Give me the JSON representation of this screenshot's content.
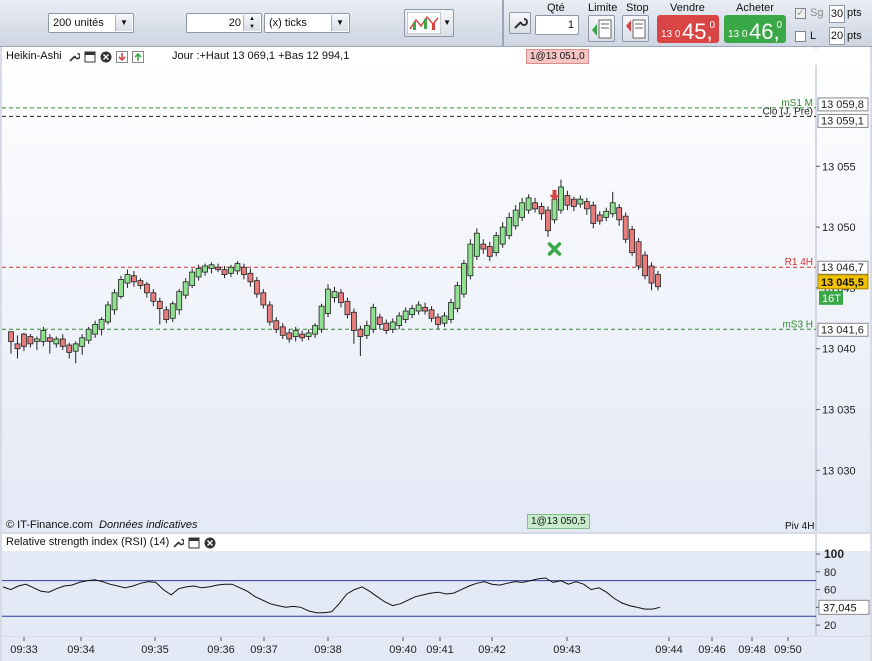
{
  "toolbar": {
    "units_value": "200 unités",
    "ticks_value": "20",
    "ticks_unit": "(x) ticks",
    "qty_label": "Qté",
    "qty_value": "1",
    "limit_label": "Limite",
    "stop_label": "Stop",
    "sell_label": "Vendre",
    "sell_small": "13 0",
    "sell_big": "45,",
    "sell_dec": "0",
    "buy_label": "Acheter",
    "buy_small": "13 0",
    "buy_big": "46,",
    "buy_dec": "0",
    "sg_label": "Sg",
    "l_label": "L",
    "pts_top": "30",
    "pts_bottom": "20",
    "pts_label": "pts",
    "colors": {
      "sell": "#d94545",
      "buy": "#3aa847"
    }
  },
  "main_panel": {
    "title": "Heikin-Ashi",
    "info": "Jour :+Haut 13 069,1 +Bas 12 994,1",
    "order_top": "1@13 051,0",
    "order_bottom": "1@13 050,5",
    "copyright": "© IT-Finance.com",
    "data_note": "Données indicatives",
    "piv_label": "Piv 4H",
    "icons": [
      "wrench-icon",
      "window-icon",
      "close-icon",
      "arrow-down-icon",
      "arrow-up-icon"
    ]
  },
  "rsi_panel": {
    "title": "Relative strength index (RSI) (14)",
    "value_label": "37,045"
  },
  "chart_data": [
    {
      "type": "candlestick",
      "chart_style": "Heikin-Ashi",
      "ylim": [
        13026,
        13063
      ],
      "yticks": [
        13030,
        13035,
        13040,
        13045,
        13050,
        13055
      ],
      "ytick_labels": [
        "13 030",
        "13 035",
        "13 040",
        "13 045",
        "13 050",
        "13 055"
      ],
      "xtick_labels": [
        "09:33",
        "09:34",
        "09:35",
        "09:36",
        "09:37",
        "09:38",
        "09:40",
        "09:41",
        "09:42",
        "09:43",
        "09:44",
        "09:46",
        "09:48",
        "09:50"
      ],
      "levels": [
        {
          "name": "mS1 M",
          "value": 13059.8,
          "label": "13 059,8",
          "color": "#2e8b2e",
          "style": "dashed"
        },
        {
          "name": "Clo (J, Pre)",
          "value": 13059.1,
          "label": "13 059,1",
          "color": "#222222",
          "style": "dashed"
        },
        {
          "name": "R1 4H",
          "value": 13046.7,
          "label": "13 046,7",
          "color": "#d03030",
          "style": "dashed"
        },
        {
          "name": "mS3 H",
          "value": 13041.6,
          "label": "13 041,6",
          "color": "#2e8b2e",
          "style": "dashed"
        }
      ],
      "current_price": {
        "value": 13045.5,
        "label": "13 045,5"
      },
      "tick_badge": "16T",
      "signals": [
        {
          "type": "arrow-down",
          "color": "#d94545",
          "value": 13052.4
        },
        {
          "type": "cross",
          "color": "#3aa847",
          "value": 13048.2
        }
      ],
      "candles": [
        [
          13041.4,
          13040.6,
          13041.0,
          13039.6
        ],
        [
          13040.4,
          13040.0,
          13041.1,
          13039.2
        ],
        [
          13041.2,
          13040.2,
          13041.3,
          13039.8
        ],
        [
          13041.0,
          13040.4,
          13041.2,
          13040.1
        ],
        [
          13040.6,
          13040.8,
          13041.0,
          13039.9
        ],
        [
          13040.6,
          13041.5,
          13041.8,
          13040.2
        ],
        [
          13040.9,
          13040.6,
          13041.2,
          13039.6
        ],
        [
          13040.4,
          13040.8,
          13041.0,
          13040.1
        ],
        [
          13040.8,
          13040.2,
          13041.2,
          13039.9
        ],
        [
          13040.3,
          13039.7,
          13040.5,
          13039.2
        ],
        [
          13039.8,
          13040.4,
          13040.6,
          13038.8
        ],
        [
          13040.2,
          13040.9,
          13041.2,
          13039.5
        ],
        [
          13040.7,
          13041.6,
          13041.8,
          13040.4
        ],
        [
          13041.2,
          13042.0,
          13042.3,
          13040.9
        ],
        [
          13041.6,
          13042.4,
          13042.6,
          13041.1
        ],
        [
          13042.2,
          13043.6,
          13043.9,
          13042.0
        ],
        [
          13043.2,
          13044.6,
          13044.9,
          13042.8
        ],
        [
          13044.3,
          13045.7,
          13046.0,
          13044.1
        ],
        [
          13045.4,
          13046.1,
          13046.5,
          13045.0
        ],
        [
          13046.0,
          13045.5,
          13046.4,
          13045.1
        ],
        [
          13045.6,
          13045.2,
          13045.8,
          13044.9
        ],
        [
          13045.3,
          13044.6,
          13045.5,
          13044.2
        ],
        [
          13044.6,
          13043.9,
          13044.9,
          13043.5
        ],
        [
          13043.9,
          13043.3,
          13044.2,
          13042.0
        ],
        [
          13043.2,
          13042.4,
          13043.5,
          13042.1
        ],
        [
          13042.5,
          13043.7,
          13043.9,
          13042.2
        ],
        [
          13043.2,
          13044.7,
          13044.9,
          13042.8
        ],
        [
          13044.4,
          13045.5,
          13045.8,
          13044.1
        ],
        [
          13045.2,
          13046.3,
          13046.6,
          13045.0
        ],
        [
          13045.9,
          13046.6,
          13046.9,
          13045.6
        ],
        [
          13046.3,
          13046.8,
          13047.0,
          13046.0
        ],
        [
          13046.6,
          13046.9,
          13047.1,
          13046.2
        ],
        [
          13046.7,
          13046.5,
          13047.0,
          13046.3
        ],
        [
          13046.5,
          13046.1,
          13046.8,
          13045.8
        ],
        [
          13046.2,
          13046.7,
          13046.9,
          13045.9
        ],
        [
          13046.4,
          13047.0,
          13047.2,
          13046.1
        ],
        [
          13046.7,
          13046.1,
          13047.0,
          13045.7
        ],
        [
          13046.2,
          13045.5,
          13046.6,
          13045.1
        ],
        [
          13045.6,
          13044.5,
          13045.9,
          13044.2
        ],
        [
          13044.6,
          13043.6,
          13044.9,
          13043.3
        ],
        [
          13043.6,
          13042.2,
          13043.9,
          13041.9
        ],
        [
          13042.3,
          13041.6,
          13042.6,
          13041.3
        ],
        [
          13041.8,
          13041.1,
          13042.1,
          13040.8
        ],
        [
          13041.3,
          13040.8,
          13041.6,
          13040.5
        ],
        [
          13041.0,
          13041.5,
          13041.8,
          13040.6
        ],
        [
          13041.2,
          13040.9,
          13041.5,
          13040.6
        ],
        [
          13041.0,
          13041.3,
          13041.6,
          13040.7
        ],
        [
          13041.2,
          13041.9,
          13042.1,
          13040.9
        ],
        [
          13041.6,
          13043.5,
          13043.7,
          13041.3
        ],
        [
          13042.9,
          13044.9,
          13045.3,
          13042.6
        ],
        [
          13044.2,
          13044.7,
          13045.1,
          13043.8
        ],
        [
          13044.6,
          13043.8,
          13044.9,
          13043.4
        ],
        [
          13043.9,
          13042.8,
          13044.2,
          13042.5
        ],
        [
          13043.0,
          13041.5,
          13043.3,
          13040.4
        ],
        [
          13041.6,
          13041.0,
          13041.9,
          13039.4
        ],
        [
          13041.1,
          13041.9,
          13042.3,
          13040.8
        ],
        [
          13041.6,
          13043.4,
          13043.7,
          13041.3
        ],
        [
          13042.6,
          13042.0,
          13042.9,
          13041.6
        ],
        [
          13042.1,
          13041.5,
          13042.4,
          13041.2
        ],
        [
          13041.6,
          13042.2,
          13042.5,
          13041.3
        ],
        [
          13041.9,
          13042.7,
          13043.0,
          13041.6
        ],
        [
          13042.4,
          13043.1,
          13043.4,
          13042.1
        ],
        [
          13042.8,
          13043.3,
          13043.6,
          13042.5
        ],
        [
          13043.1,
          13043.6,
          13043.9,
          13042.8
        ],
        [
          13043.4,
          13043.1,
          13043.8,
          13042.8
        ],
        [
          13043.2,
          13042.5,
          13043.5,
          13042.2
        ],
        [
          13042.6,
          13042.0,
          13042.9,
          13041.6
        ],
        [
          13042.1,
          13042.7,
          13043.0,
          13041.8
        ],
        [
          13042.4,
          13043.8,
          13044.1,
          13042.1
        ],
        [
          13043.3,
          13045.2,
          13045.5,
          13043.0
        ],
        [
          13044.5,
          13047.0,
          13047.3,
          13044.2
        ],
        [
          13046.0,
          13048.6,
          13049.0,
          13045.7
        ],
        [
          13047.6,
          13049.5,
          13049.9,
          13047.3
        ],
        [
          13048.6,
          13048.2,
          13049.0,
          13047.8
        ],
        [
          13048.4,
          13047.6,
          13048.8,
          13047.2
        ],
        [
          13047.9,
          13049.3,
          13049.6,
          13047.6
        ],
        [
          13048.6,
          13050.0,
          13050.4,
          13048.3
        ],
        [
          13049.3,
          13050.8,
          13051.2,
          13049.0
        ],
        [
          13050.1,
          13051.4,
          13051.8,
          13049.8
        ],
        [
          13050.8,
          13052.0,
          13052.4,
          13050.5
        ],
        [
          13051.4,
          13052.4,
          13052.7,
          13051.1
        ],
        [
          13052.0,
          13051.5,
          13052.4,
          13051.2
        ],
        [
          13051.7,
          13051.1,
          13052.0,
          13050.6
        ],
        [
          13051.4,
          13049.7,
          13051.7,
          13049.2
        ],
        [
          13050.6,
          13052.3,
          13052.9,
          13050.3
        ],
        [
          13051.4,
          13053.3,
          13053.9,
          13051.1
        ],
        [
          13052.6,
          13051.8,
          13053.0,
          13051.4
        ],
        [
          13052.3,
          13051.7,
          13052.5,
          13051.3
        ],
        [
          13051.9,
          13052.3,
          13052.6,
          13051.6
        ],
        [
          13052.1,
          13051.5,
          13052.4,
          13051.0
        ],
        [
          13051.8,
          13050.3,
          13052.1,
          13049.9
        ],
        [
          13051.0,
          13050.5,
          13051.3,
          13050.2
        ],
        [
          13050.8,
          13051.3,
          13051.6,
          13050.5
        ],
        [
          13051.1,
          13052.0,
          13052.9,
          13050.8
        ],
        [
          13051.6,
          13050.6,
          13051.9,
          13050.1
        ],
        [
          13050.9,
          13049.0,
          13051.2,
          13048.7
        ],
        [
          13049.8,
          13047.9,
          13050.1,
          13047.6
        ],
        [
          13048.8,
          13046.8,
          13049.1,
          13046.5
        ],
        [
          13047.7,
          13046.0,
          13048.0,
          13045.7
        ],
        [
          13046.8,
          13045.4,
          13047.1,
          13044.8
        ],
        [
          13046.1,
          13045.1,
          13046.4,
          13044.8
        ]
      ]
    },
    {
      "type": "line",
      "name": "RSI (14)",
      "ylim": [
        10,
        100
      ],
      "yticks": [
        20,
        40,
        60,
        80,
        100
      ],
      "levels": [
        70,
        30
      ],
      "values": [
        63,
        60,
        64,
        66,
        62,
        58,
        57,
        61,
        64,
        65,
        68,
        70,
        71,
        69,
        66,
        64,
        62,
        64,
        67,
        69,
        68,
        60,
        54,
        61,
        63,
        64,
        62,
        63,
        65,
        66,
        66,
        62,
        58,
        52,
        48,
        44,
        42,
        40,
        41,
        40,
        36,
        34,
        34,
        35,
        44,
        55,
        60,
        63,
        58,
        52,
        46,
        42,
        44,
        48,
        52,
        54,
        56,
        57,
        55,
        56,
        60,
        64,
        67,
        69,
        66,
        65,
        67,
        69,
        68,
        70,
        72,
        73,
        68,
        70,
        66,
        69,
        66,
        60,
        62,
        57,
        50,
        45,
        42,
        40,
        38,
        38,
        40
      ]
    }
  ]
}
